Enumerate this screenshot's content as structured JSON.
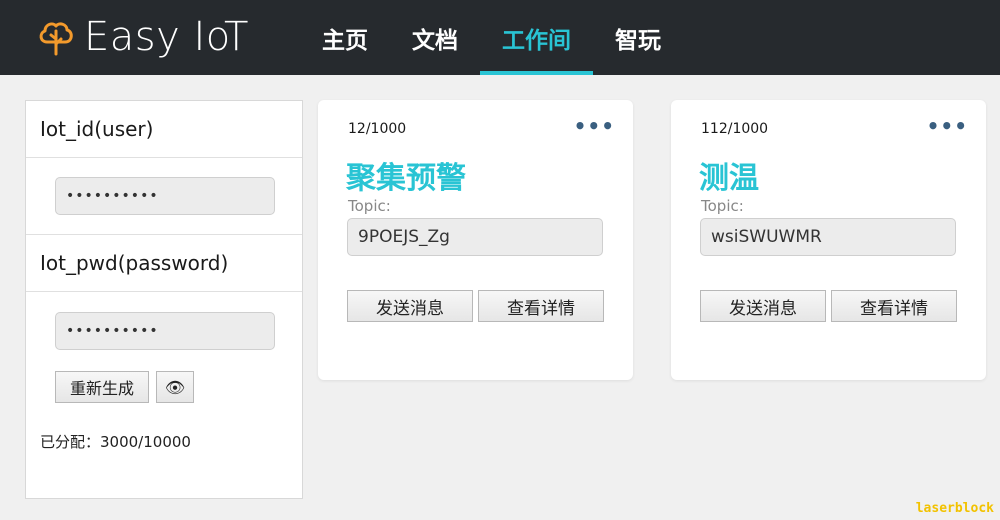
{
  "header": {
    "logo_text": "Easy IoT",
    "nav": [
      {
        "label": "主页"
      },
      {
        "label": "文档"
      },
      {
        "label": "工作间"
      },
      {
        "label": "智玩"
      }
    ]
  },
  "panel": {
    "user_label": "Iot_id(user)",
    "user_value": "••••••••••",
    "pwd_label": "Iot_pwd(password)",
    "pwd_value": "••••••••••",
    "regen_label": "重新生成",
    "eye_icon": "👁",
    "allocated": "已分配：3000/10000"
  },
  "cards": [
    {
      "count": "12/1000",
      "menu": "•••",
      "title": "聚集预警",
      "topic_label": "Topic:",
      "topic_value": "9POEJS_Zg",
      "send_label": "发送消息",
      "detail_label": "查看详情"
    },
    {
      "count": "112/1000",
      "menu": "•••",
      "title": "测温",
      "topic_label": "Topic:",
      "topic_value": "wsiSWUWMR",
      "send_label": "发送消息",
      "detail_label": "查看详情"
    }
  ],
  "watermark": "laserblock",
  "colors": {
    "accent": "#29c4d4",
    "header_bg": "#262a2e",
    "logo": "#f39a2c"
  }
}
